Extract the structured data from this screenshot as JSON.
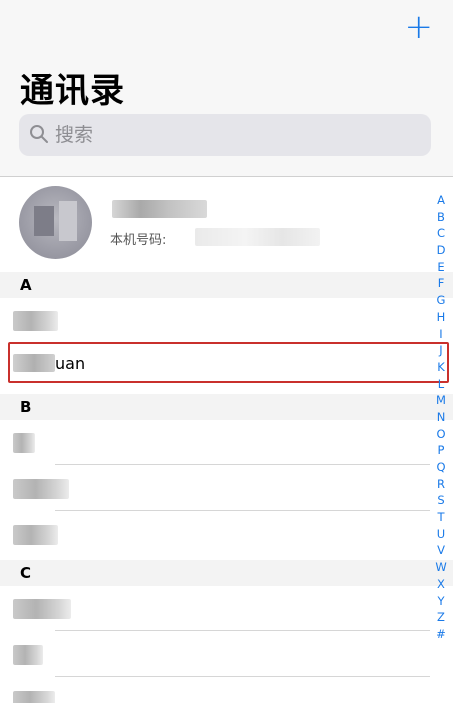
{
  "header": {
    "add_label": "+",
    "title": "通讯录",
    "search_placeholder": "搜索"
  },
  "my_card": {
    "phone_label": "本机号码:"
  },
  "sections": [
    {
      "letter": "A",
      "contacts": [
        {
          "visible_suffix": ""
        },
        {
          "visible_suffix": "uan",
          "highlighted": true
        }
      ]
    },
    {
      "letter": "B",
      "contacts": [
        {
          "visible_suffix": ""
        },
        {
          "visible_suffix": ""
        },
        {
          "visible_suffix": ""
        }
      ]
    },
    {
      "letter": "C",
      "contacts": [
        {
          "visible_suffix": ""
        },
        {
          "visible_suffix": ""
        },
        {
          "visible_suffix": ""
        }
      ]
    }
  ],
  "index_letters": [
    "A",
    "B",
    "C",
    "D",
    "E",
    "F",
    "G",
    "H",
    "I",
    "J",
    "K",
    "L",
    "M",
    "N",
    "O",
    "P",
    "Q",
    "R",
    "S",
    "T",
    "U",
    "V",
    "W",
    "X",
    "Y",
    "Z",
    "#"
  ],
  "colors": {
    "accent": "#1a7ae8",
    "highlight_border": "#c9302c",
    "header_bg": "#f7f7f7"
  }
}
